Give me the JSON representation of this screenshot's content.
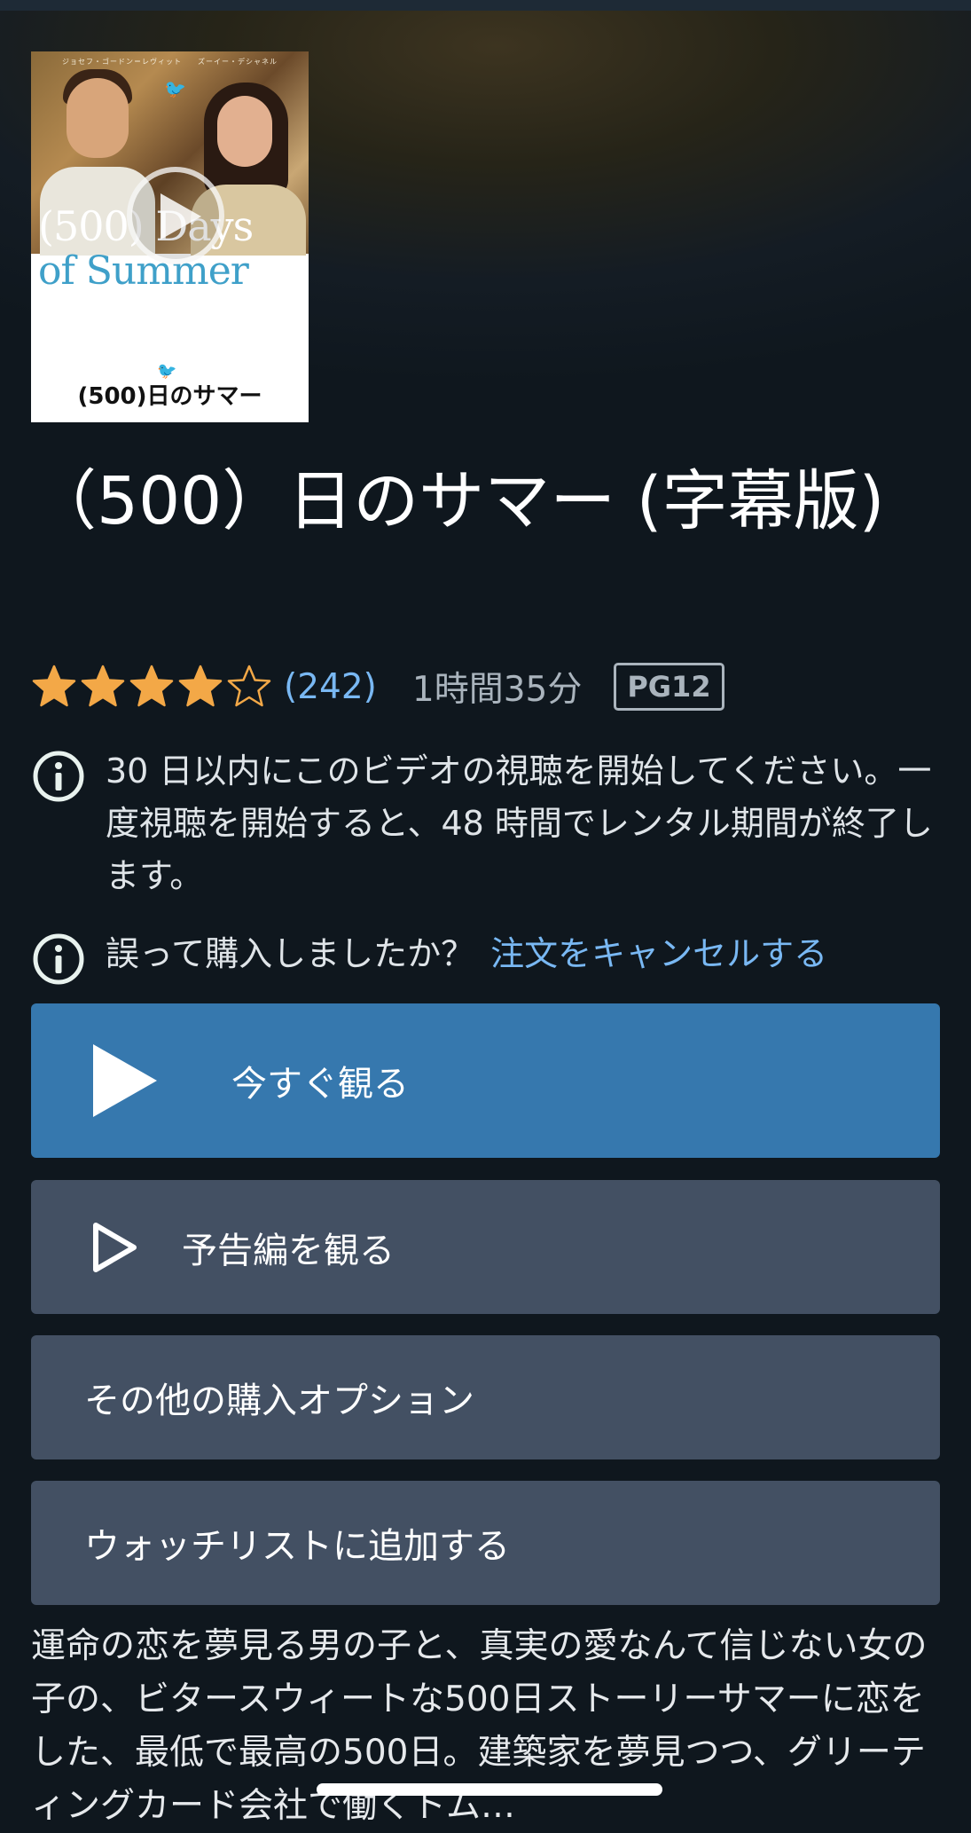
{
  "poster": {
    "credits": "ジョセフ・ゴードン＝レヴィット　　ズーイー・デシャネル",
    "title_en_line1": "(500) Days",
    "title_en_line2": "of Summer",
    "title_jp": "(500)日のサマー"
  },
  "movie": {
    "title": "（500）日のサマー (字幕版)",
    "rating_stars": 4,
    "rating_max": 5,
    "review_count": "(242)",
    "runtime": "1時間35分",
    "content_rating": "PG12"
  },
  "notices": {
    "rental_info": "30 日以内にこのビデオの視聴を開始してください。一度視聴を開始すると、48 時間でレンタル期間が終了します。",
    "mistake_prompt": "誤って購入しましたか？",
    "cancel_link": "注文をキャンセルする"
  },
  "actions": {
    "watch_now": "今すぐ観る",
    "watch_trailer": "予告編を観る",
    "more_options": "その他の購入オプション",
    "add_watchlist": "ウォッチリストに追加する"
  },
  "description": "運命の恋を夢見る男の子と、真実の愛なんて信じない女の子の、ビタースウィートな500日ストーリーサマーに恋をした、最低で最高の500日。建築家を夢見つつ、グリーティングカード会社で働くトム…",
  "colors": {
    "background": "#0f171e",
    "primary_button": "#3678ae",
    "secondary_button": "#435063",
    "link": "#79b8f3",
    "star": "#f3a847"
  },
  "icons": {
    "play": "play-icon",
    "play_outline": "play-outline-icon",
    "info": "info-icon",
    "star_filled": "star-filled-icon",
    "star_empty": "star-empty-icon"
  }
}
